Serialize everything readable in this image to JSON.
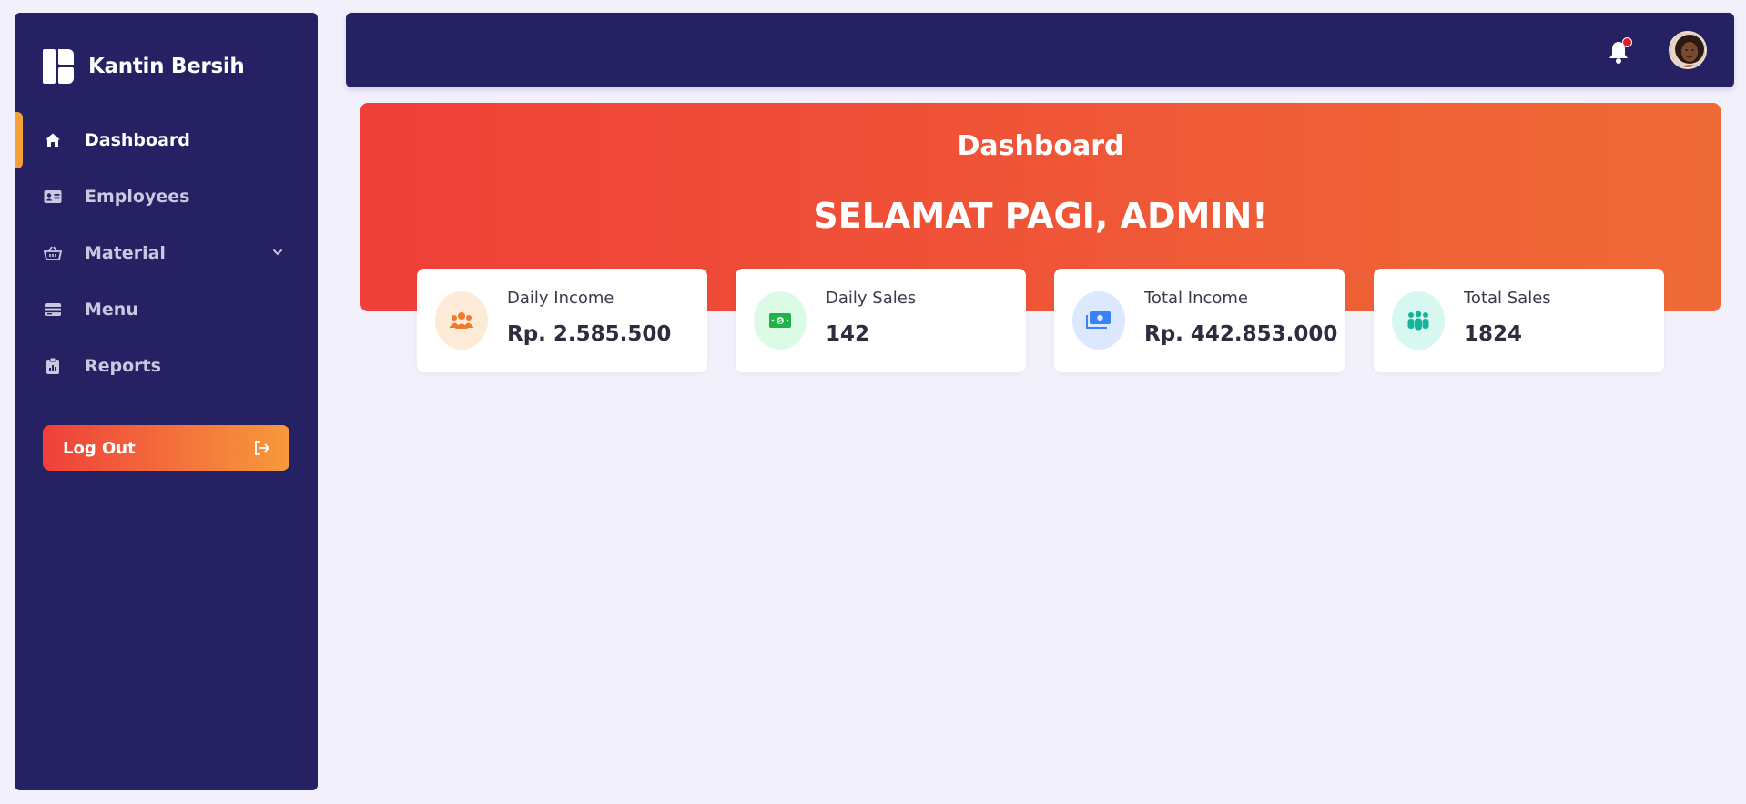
{
  "brand": {
    "name": "Kantin Bersih"
  },
  "sidebar": {
    "items": [
      {
        "label": "Dashboard",
        "icon": "home-icon",
        "active": true
      },
      {
        "label": "Employees",
        "icon": "id-card-icon",
        "active": false
      },
      {
        "label": "Material",
        "icon": "basket-icon",
        "active": false,
        "has_submenu": true
      },
      {
        "label": "Menu",
        "icon": "menu-list-icon",
        "active": false
      },
      {
        "label": "Reports",
        "icon": "clipboard-icon",
        "active": false
      }
    ],
    "logout_label": "Log Out"
  },
  "topbar": {
    "notification_icon": "bell-icon",
    "has_unread": true
  },
  "banner": {
    "title": "Dashboard",
    "greeting": "SELAMAT PAGI, ADMIN!"
  },
  "stats": [
    {
      "label": "Daily Income",
      "value": "Rp. 2.585.500",
      "icon": "users-icon",
      "icon_color": "#f17a2a",
      "bg": "#fdebd7"
    },
    {
      "label": "Daily Sales",
      "value": "142",
      "icon": "money-bill-icon",
      "icon_color": "#22b24c",
      "bg": "#dcfbe6"
    },
    {
      "label": "Total Income",
      "value": "Rp. 442.853.000",
      "icon": "money-stack-icon",
      "icon_color": "#3b82f6",
      "bg": "#dbe8fe"
    },
    {
      "label": "Total Sales",
      "value": "1824",
      "icon": "people-group-icon",
      "icon_color": "#15b39a",
      "bg": "#d6f8f1"
    }
  ],
  "colors": {
    "sidebar_bg": "#262163",
    "accent": "#f5a13a",
    "banner_start": "#ef3f38",
    "banner_end": "#ef6b36",
    "page_bg": "#f1f0fb"
  }
}
